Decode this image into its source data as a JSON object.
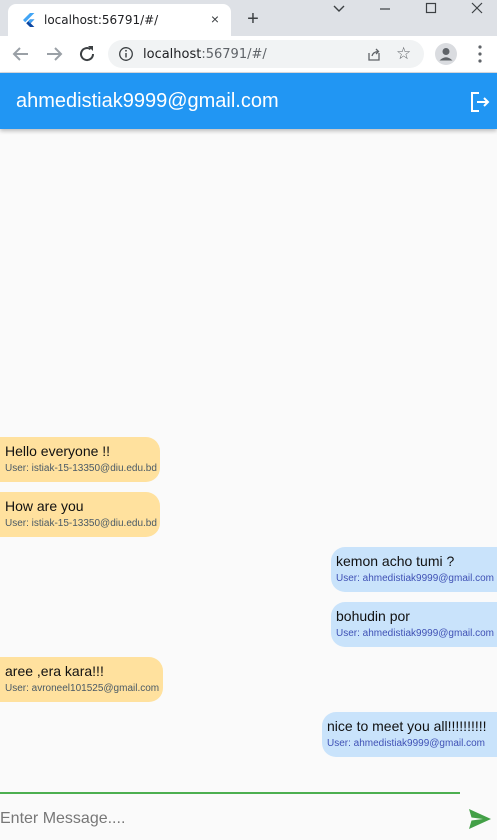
{
  "browser": {
    "tab_title": "localhost:56791/#/",
    "url_host": "localhost",
    "url_rest": ":56791/#/",
    "new_tab": "+",
    "tab_close": "×"
  },
  "app": {
    "title": "ahmedistiak9999@gmail.com",
    "accent": "#2196f3"
  },
  "messages": [
    {
      "text": "Hello everyone !!",
      "user": "User: istiak-15-13350@diu.edu.bd",
      "side": "in"
    },
    {
      "text": "How are you",
      "user": "User: istiak-15-13350@diu.edu.bd",
      "side": "in"
    },
    {
      "text": "kemon acho tumi ?",
      "user": "User: ahmedistiak9999@gmail.com",
      "side": "out"
    },
    {
      "text": "bohudin por",
      "user": "User: ahmedistiak9999@gmail.com",
      "side": "out"
    },
    {
      "text": "aree ,era kara!!!",
      "user": "User: avroneel101525@gmail.com",
      "side": "in"
    },
    {
      "text": "nice to meet you all!!!!!!!!!!",
      "user": "User: ahmedistiak9999@gmail.com",
      "side": "out"
    }
  ],
  "composer": {
    "placeholder": "Enter Message....",
    "value": ""
  },
  "icons": {
    "logout": "logout-icon",
    "send": "send-icon"
  }
}
